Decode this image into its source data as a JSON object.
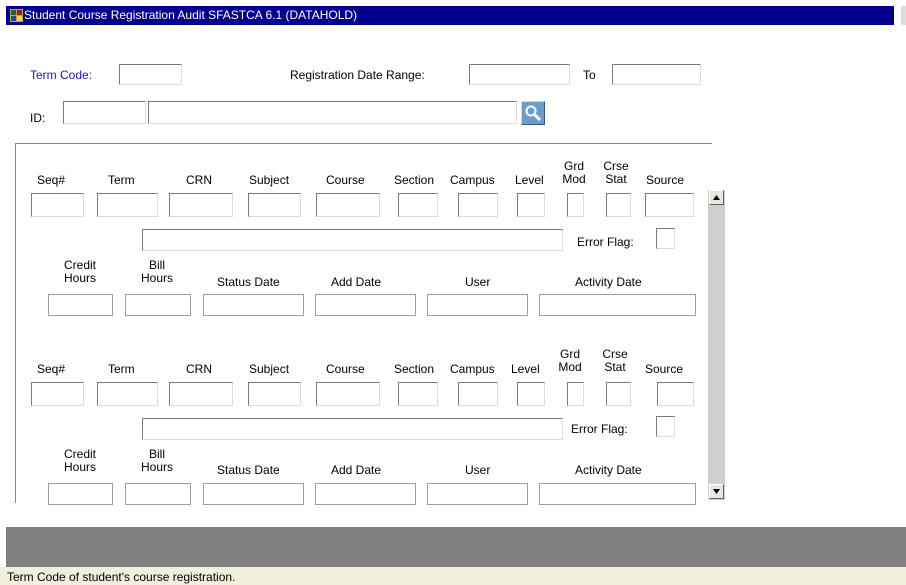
{
  "window": {
    "title": "Student Course Registration Audit  SFASTCA  6.1  (DATAHOLD)"
  },
  "key_block": {
    "term_code_label": "Term Code:",
    "term_code_value": "",
    "reg_date_range_label": "Registration Date Range:",
    "reg_date_from": "",
    "to_label": "To",
    "reg_date_to": "",
    "id_label": "ID:",
    "id_value": "",
    "name_value": ""
  },
  "labels": {
    "seq": "Seq#",
    "term": "Term",
    "crn": "CRN",
    "subject": "Subject",
    "course": "Course",
    "section": "Section",
    "campus": "Campus",
    "level": "Level",
    "grd_mod_1": "Grd",
    "grd_mod_2": "Mod",
    "crse_stat_1": "Crse",
    "crse_stat_2": "Stat",
    "source": "Source",
    "error_flag": "Error Flag:",
    "credit_1": "Credit",
    "credit_2": "Hours",
    "bill_1": "Bill",
    "bill_2": "Hours",
    "status_date": "Status Date",
    "add_date": "Add Date",
    "user": "User",
    "activity_date": "Activity Date"
  },
  "records": [
    {
      "seq": "",
      "term": "",
      "crn": "",
      "subject": "",
      "course": "",
      "section": "",
      "campus": "",
      "level": "",
      "grd_mod": "",
      "crse_stat": "",
      "source": "",
      "message": "",
      "error_flag": "",
      "credit_hours": "",
      "bill_hours": "",
      "status_date": "",
      "add_date": "",
      "user": "",
      "activity_date": ""
    },
    {
      "seq": "",
      "term": "",
      "crn": "",
      "subject": "",
      "course": "",
      "section": "",
      "campus": "",
      "level": "",
      "grd_mod": "",
      "crse_stat": "",
      "source": "",
      "message": "",
      "error_flag": "",
      "credit_hours": "",
      "bill_hours": "",
      "status_date": "",
      "add_date": "",
      "user": "",
      "activity_date": ""
    }
  ],
  "status_bar": {
    "hint": "Term Code of student's course registration."
  },
  "icons": {
    "window_icon": "banner-app-icon",
    "search": "search-icon",
    "scroll_up": "arrow-up-icon",
    "scroll_down": "arrow-down-icon"
  },
  "colors": {
    "titlebar": "#00008a",
    "label_blue": "#1a1aa8",
    "statusbar": "#f1eedc",
    "gray_area": "#808080"
  }
}
